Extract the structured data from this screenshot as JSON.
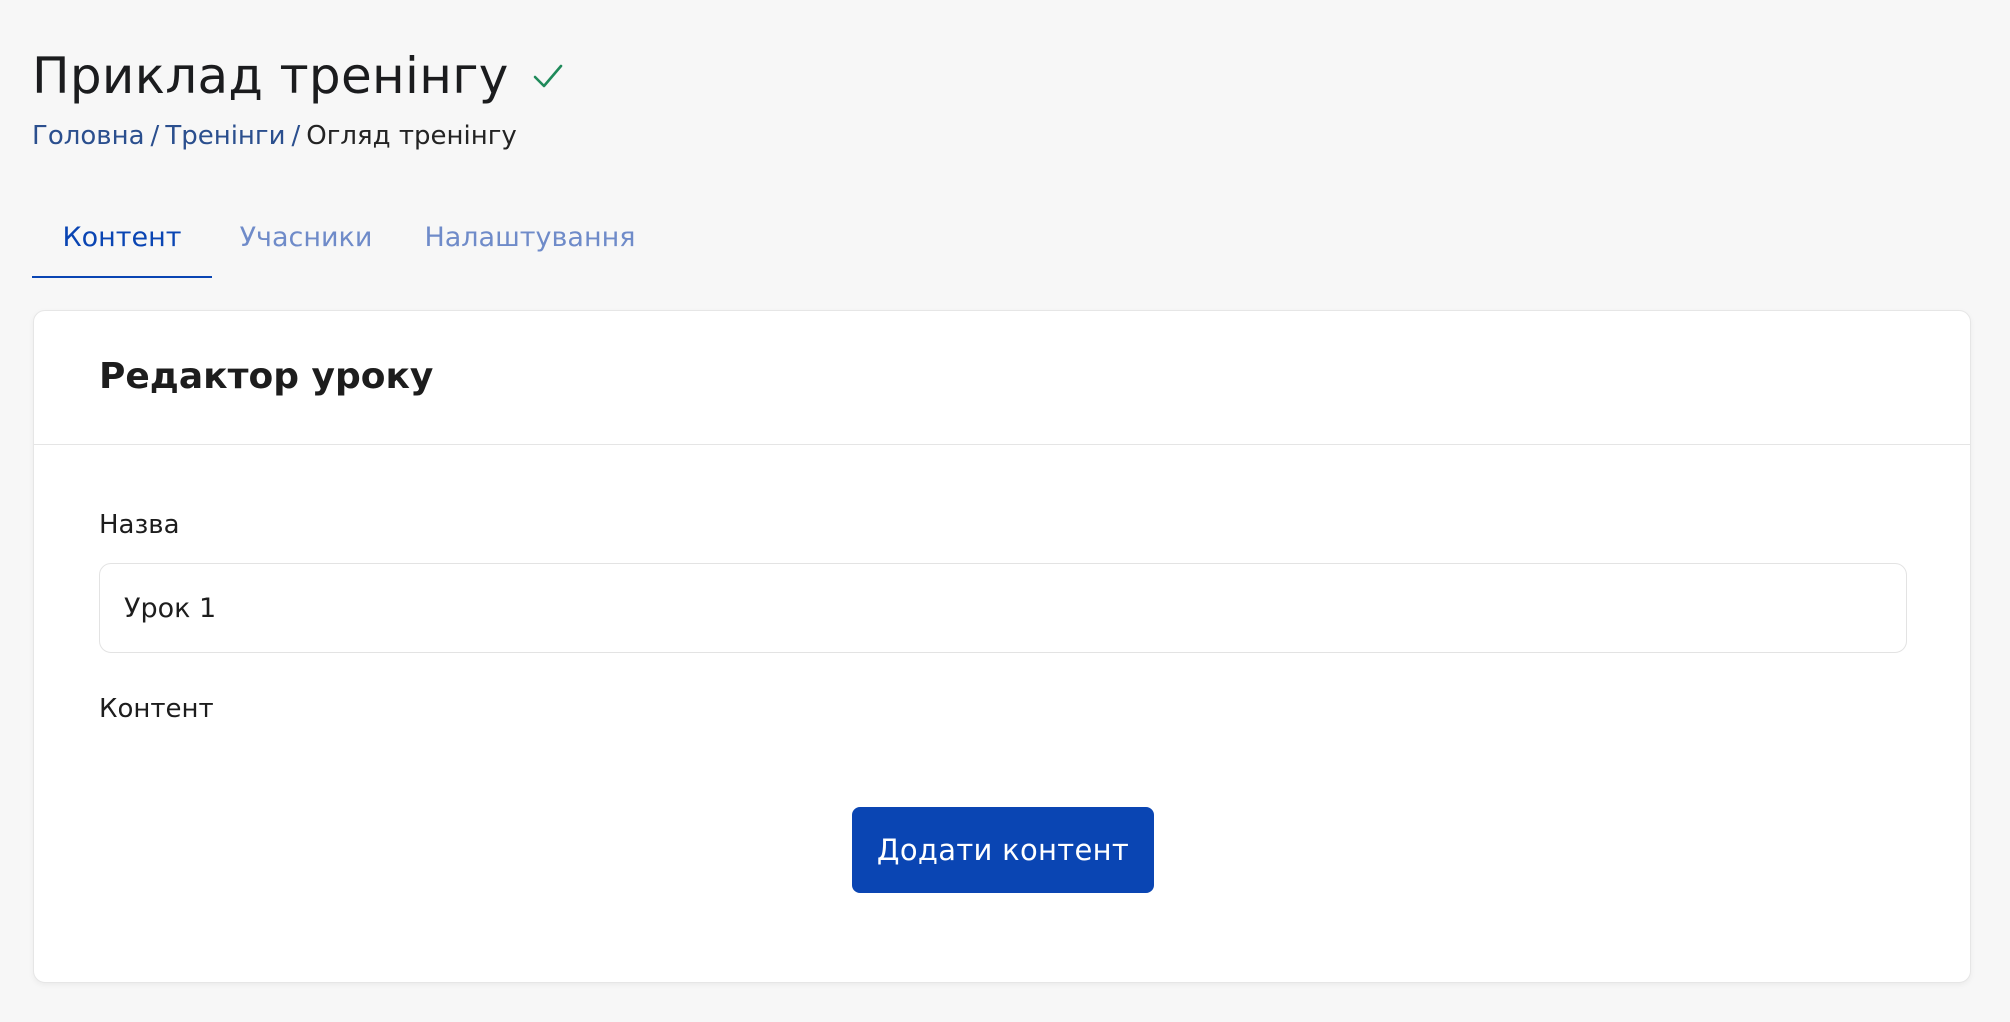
{
  "header": {
    "title": "Приклад тренінгу",
    "status_icon": "check-icon",
    "status_color": "#1f8a5a"
  },
  "breadcrumb": {
    "items": [
      {
        "label": "Головна",
        "link": true
      },
      {
        "label": "Тренінги",
        "link": true
      },
      {
        "label": "Огляд тренінгу",
        "link": false
      }
    ],
    "separator": "/"
  },
  "tabs": [
    {
      "label": "Контент",
      "active": true
    },
    {
      "label": "Учасники",
      "active": false
    },
    {
      "label": "Налаштування",
      "active": false
    }
  ],
  "editor": {
    "title": "Редактор уроку",
    "name_label": "Назва",
    "name_value": "Урок 1",
    "content_label": "Контент",
    "add_button_label": "Додати контент"
  },
  "colors": {
    "accent": "#0a45b3",
    "link": "#2b4f8e",
    "tab_inactive": "#6f8bc9",
    "background": "#f7f7f7"
  }
}
